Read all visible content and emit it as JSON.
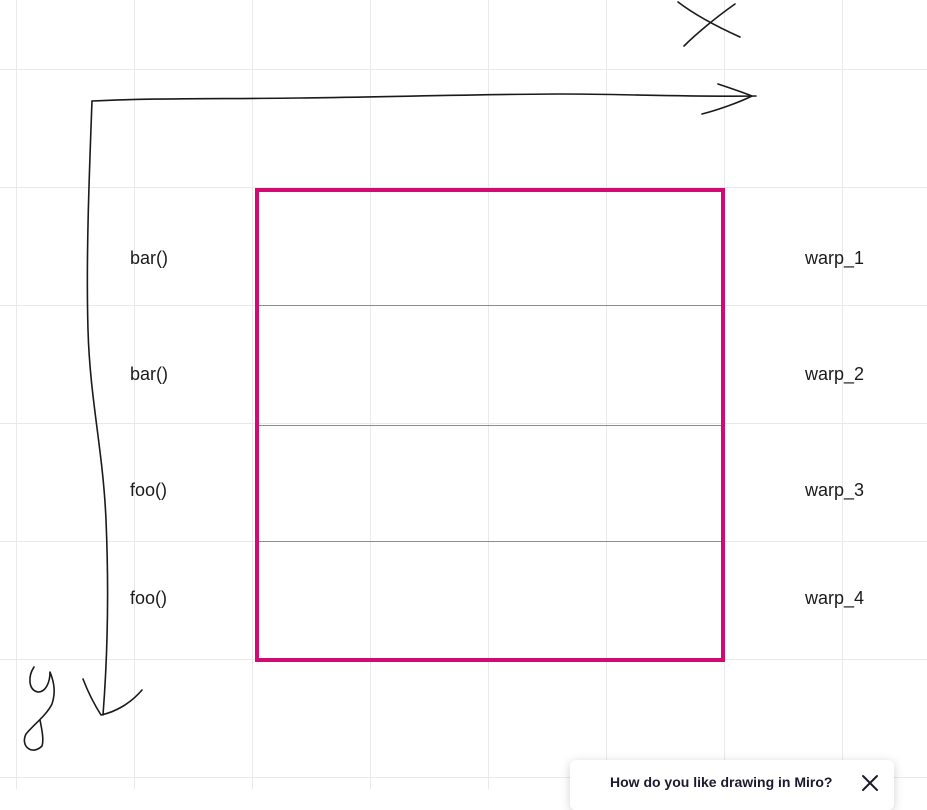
{
  "canvas": {
    "functions": [
      "bar()",
      "bar()",
      "foo()",
      "foo()"
    ],
    "warps": [
      "warp_1",
      "warp_2",
      "warp_3",
      "warp_4"
    ],
    "frame_color": "#d10b72",
    "axis_x_icon": "x-letter-sketch",
    "axis_y_icon": "y-letter-sketch"
  },
  "feedback": {
    "question": "How do you like drawing in Miro?",
    "close_icon": "close-icon"
  }
}
